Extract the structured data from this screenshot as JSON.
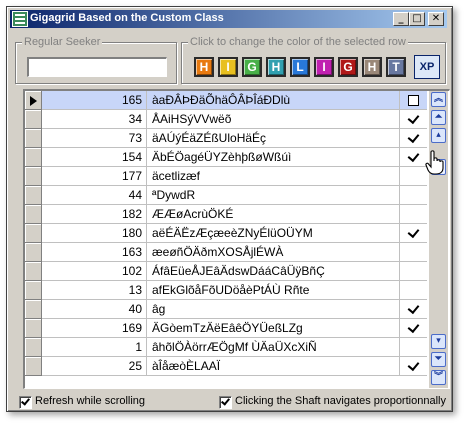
{
  "window": {
    "title": "Gigagrid Based on the Custom Class",
    "controls": {
      "minimize": "_",
      "maximize": "□",
      "close": "✕"
    }
  },
  "seeker": {
    "legend": "Regular Seeker",
    "value": ""
  },
  "color_picker": {
    "legend": "Click to change the color of the selected row",
    "buttons": [
      {
        "label": "H",
        "color": "#e87a10"
      },
      {
        "label": "I",
        "color": "#e8c020"
      },
      {
        "label": "G",
        "color": "#48b048"
      },
      {
        "label": "H",
        "color": "#30a0b0"
      },
      {
        "label": "L",
        "color": "#2878d8"
      },
      {
        "label": "I",
        "color": "#c020b0"
      },
      {
        "label": "G",
        "color": "#b01818"
      },
      {
        "label": "H",
        "color": "#9a8878"
      },
      {
        "label": "T",
        "color": "#6878a0"
      }
    ],
    "xp_label": "XP"
  },
  "grid": {
    "rows": [
      {
        "num": "165",
        "text": "àaÐÂÞÐäÕhäÔÂÞÎáÐDlù",
        "check": "box",
        "selected": true
      },
      {
        "num": "34",
        "text": "ÅAiHSýVVwëõ",
        "check": "yes",
        "selected": false
      },
      {
        "num": "73",
        "text": "äAÚýÉäZÉßUloHäÉç",
        "check": "yes",
        "selected": false
      },
      {
        "num": "154",
        "text": "ÄbÉÖagéÜYZèhþßøWßúì",
        "check": "yes",
        "selected": false
      },
      {
        "num": "177",
        "text": "äcetlizæf",
        "check": "no",
        "selected": false
      },
      {
        "num": "44",
        "text": "ªDywdR",
        "check": "no",
        "selected": false
      },
      {
        "num": "182",
        "text": "ÆÆøAcrùÖKÉ",
        "check": "no",
        "selected": false
      },
      {
        "num": "180",
        "text": "aëÉÄËzÆçæeèZNyÉlüOÜYM",
        "check": "yes",
        "selected": false
      },
      {
        "num": "163",
        "text": "æeøñÖÄðmXOSÅjlÉWÀ",
        "check": "no",
        "selected": false
      },
      {
        "num": "102",
        "text": "ÁfâEüeÅJEâÄdswDááCâÜÿBñÇ",
        "check": "no",
        "selected": false
      },
      {
        "num": "13",
        "text": "afEkGlõåFõUDöåèPtÁÙ Rñte",
        "check": "no",
        "selected": false
      },
      {
        "num": "40",
        "text": "âg",
        "check": "yes",
        "selected": false
      },
      {
        "num": "169",
        "text": "ÄGòemTzÄëEâêÖYÜeßLZg",
        "check": "yes",
        "selected": false
      },
      {
        "num": "1",
        "text": "âhõlÖÀörrÆÖgMf ÙÄaÜXcXiÑ",
        "check": "no",
        "selected": false
      },
      {
        "num": "25",
        "text": "àÎåæòÈLAAÏ",
        "check": "yes",
        "selected": false
      }
    ]
  },
  "scrollbar": {
    "icons": [
      "double-up-icon",
      "page-up-icon",
      "up-icon",
      "down-icon",
      "page-down-icon",
      "double-down-icon"
    ]
  },
  "options": {
    "refresh_label": "Refresh while scrolling",
    "refresh_checked": true,
    "shaft_label": "Clicking the Shaft navigates proportionnally",
    "shaft_checked": true
  }
}
